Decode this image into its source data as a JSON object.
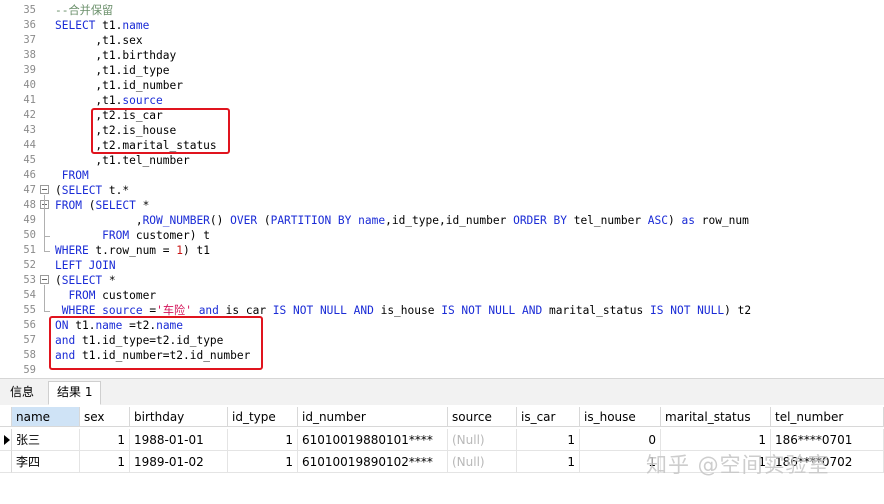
{
  "editor": {
    "lines": [
      {
        "n": "35",
        "parts": [
          [
            "cm",
            "--合并保留"
          ]
        ]
      },
      {
        "n": "36",
        "parts": [
          [
            "kw",
            "SELECT "
          ],
          [
            "pl",
            "t1."
          ],
          [
            "kw",
            "name"
          ]
        ]
      },
      {
        "n": "37",
        "parts": [
          [
            "pl",
            "      ,t1.sex"
          ]
        ]
      },
      {
        "n": "38",
        "parts": [
          [
            "pl",
            "      ,t1.birthday"
          ]
        ]
      },
      {
        "n": "39",
        "parts": [
          [
            "pl",
            "      ,t1.id_type"
          ]
        ]
      },
      {
        "n": "40",
        "parts": [
          [
            "pl",
            "      ,t1.id_number"
          ]
        ]
      },
      {
        "n": "41",
        "parts": [
          [
            "pl",
            "      ,t1."
          ],
          [
            "kw",
            "source"
          ]
        ]
      },
      {
        "n": "42",
        "parts": [
          [
            "pl",
            "      ,t2.is_car"
          ]
        ]
      },
      {
        "n": "43",
        "parts": [
          [
            "pl",
            "      ,t2.is_house"
          ]
        ]
      },
      {
        "n": "44",
        "parts": [
          [
            "pl",
            "      ,t2.marital_status"
          ]
        ]
      },
      {
        "n": "45",
        "parts": [
          [
            "pl",
            "      ,t1.tel_number"
          ]
        ]
      },
      {
        "n": "46",
        "parts": [
          [
            "kw",
            " FROM"
          ]
        ]
      },
      {
        "n": "47",
        "parts": [
          [
            "pl",
            "("
          ],
          [
            "kw",
            "SELECT "
          ],
          [
            "pl",
            "t.*"
          ]
        ]
      },
      {
        "n": "48",
        "parts": [
          [
            "kw",
            "FROM "
          ],
          [
            "pl",
            "("
          ],
          [
            "kw",
            "SELECT "
          ],
          [
            "pl",
            "*"
          ]
        ]
      },
      {
        "n": "49",
        "parts": [
          [
            "pl",
            "            ,"
          ],
          [
            "fn",
            "ROW_NUMBER"
          ],
          [
            "pl",
            "() "
          ],
          [
            "kw",
            "OVER "
          ],
          [
            "pl",
            "("
          ],
          [
            "kw",
            "PARTITION BY "
          ],
          [
            "kw",
            "name"
          ],
          [
            "pl",
            ",id_type,id_number "
          ],
          [
            "kw",
            "ORDER BY "
          ],
          [
            "pl",
            "tel_number "
          ],
          [
            "kw",
            "ASC"
          ],
          [
            "pl",
            ") "
          ],
          [
            "kw",
            "as "
          ],
          [
            "pl",
            "row_num"
          ]
        ]
      },
      {
        "n": "50",
        "parts": [
          [
            "pl",
            "       "
          ],
          [
            "kw",
            "FROM "
          ],
          [
            "pl",
            "customer) t"
          ]
        ]
      },
      {
        "n": "51",
        "parts": [
          [
            "kw",
            "WHERE "
          ],
          [
            "pl",
            "t.row_num = "
          ],
          [
            "nu",
            "1"
          ],
          [
            "pl",
            ") t1"
          ]
        ]
      },
      {
        "n": "52",
        "parts": [
          [
            "kw",
            "LEFT JOIN"
          ]
        ]
      },
      {
        "n": "53",
        "parts": [
          [
            "pl",
            "("
          ],
          [
            "kw",
            "SELECT "
          ],
          [
            "pl",
            "*"
          ]
        ]
      },
      {
        "n": "54",
        "parts": [
          [
            "pl",
            "  "
          ],
          [
            "kw",
            "FROM "
          ],
          [
            "pl",
            "customer"
          ]
        ]
      },
      {
        "n": "55",
        "parts": [
          [
            "pl",
            " "
          ],
          [
            "kw",
            "WHERE "
          ],
          [
            "kw",
            "source "
          ],
          [
            "pl",
            "="
          ],
          [
            "st",
            "'车险'"
          ],
          [
            "pl",
            " "
          ],
          [
            "kw",
            "and "
          ],
          [
            "pl",
            "is_car "
          ],
          [
            "kw",
            "IS NOT NULL AND "
          ],
          [
            "pl",
            "is_house "
          ],
          [
            "kw",
            "IS NOT NULL AND "
          ],
          [
            "pl",
            "marital_status "
          ],
          [
            "kw",
            "IS NOT NULL"
          ],
          [
            "pl",
            ") t2"
          ]
        ]
      },
      {
        "n": "56",
        "parts": [
          [
            "kw",
            "ON "
          ],
          [
            "pl",
            "t1."
          ],
          [
            "kw",
            "name "
          ],
          [
            "pl",
            "=t2."
          ],
          [
            "kw",
            "name"
          ]
        ]
      },
      {
        "n": "57",
        "parts": [
          [
            "kw",
            "and "
          ],
          [
            "pl",
            "t1.id_type=t2.id_type"
          ]
        ]
      },
      {
        "n": "58",
        "parts": [
          [
            "kw",
            "and "
          ],
          [
            "pl",
            "t1.id_number=t2.id_number"
          ]
        ]
      },
      {
        "n": "59",
        "parts": []
      }
    ]
  },
  "tabs": [
    {
      "label": "信息"
    },
    {
      "label": "结果 1"
    }
  ],
  "table": {
    "columns": [
      "name",
      "sex",
      "birthday",
      "id_type",
      "id_number",
      "source",
      "is_car",
      "is_house",
      "marital_status",
      "tel_number"
    ],
    "rows": [
      [
        "张三",
        "1",
        "1988-01-01",
        "1",
        "61010019880101****",
        "(Null)",
        "1",
        "0",
        "1",
        "186****0701"
      ],
      [
        "李四",
        "1",
        "1989-01-02",
        "1",
        "61010019890102****",
        "(Null)",
        "1",
        "1",
        "1",
        "186****0702"
      ]
    ]
  },
  "watermark": "知乎 @空间实验室",
  "colors": {
    "keyword": "#1a2bd6",
    "comment": "#6a8f6a",
    "string": "#d4145a",
    "number": "#c81414",
    "highlight_box": "#e0141e",
    "selected_header": "#cfe3f6"
  }
}
